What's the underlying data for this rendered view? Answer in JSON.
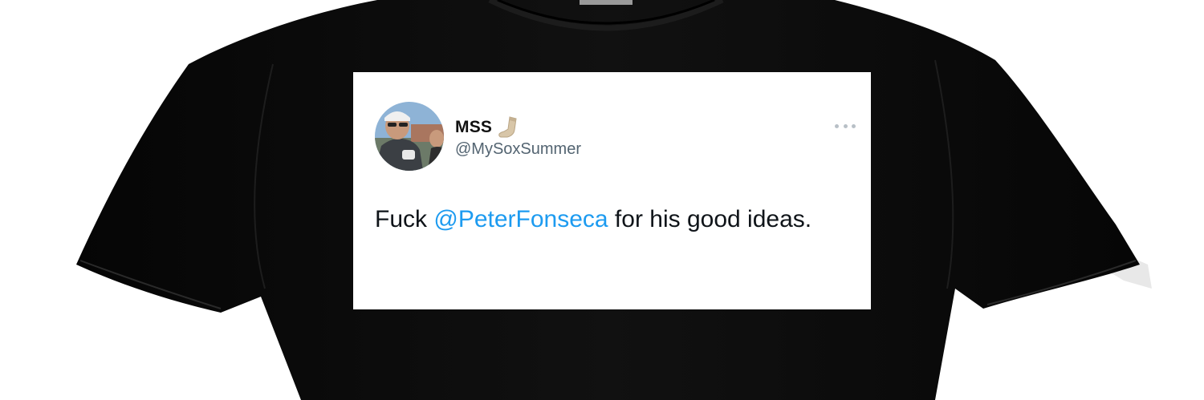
{
  "tweet": {
    "display_name": "MSS",
    "handle": "@MySoxSummer",
    "text_before": "Fuck ",
    "mention": "@PeterFonseca",
    "text_after": " for his good ideas.",
    "more_icon": "ellipsis-icon",
    "name_emoji_icon": "sock-icon",
    "mention_color": "#1d9bf0"
  },
  "shirt": {
    "color": "#0a0a0a"
  }
}
